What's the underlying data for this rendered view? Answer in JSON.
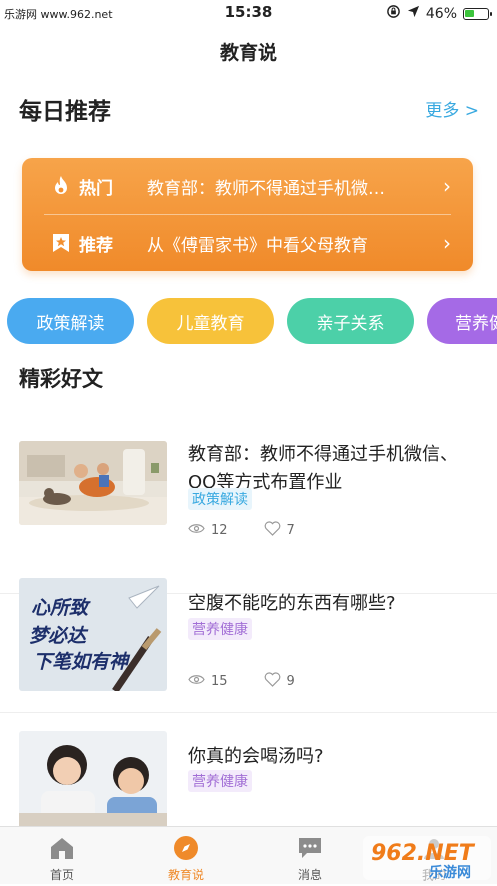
{
  "status": {
    "watermark": "乐游网 www.962.net",
    "time": "15:38",
    "battery": "46%",
    "battery_level": 0.46
  },
  "nav": {
    "title": "教育说"
  },
  "daily": {
    "heading": "每日推荐",
    "more": "更多 >",
    "items": [
      {
        "tag": "热门",
        "text": "教育部：教师不得通过手机微…",
        "icon": "flame-icon"
      },
      {
        "tag": "推荐",
        "text": "从《傅雷家书》中看父母教育",
        "icon": "star-badge-icon"
      }
    ]
  },
  "categories": [
    {
      "label": "政策解读",
      "color": "#4aaaf0"
    },
    {
      "label": "儿童教育",
      "color": "#f7c23a"
    },
    {
      "label": "亲子关系",
      "color": "#4cd0a8"
    },
    {
      "label": "营养健",
      "color": "#a56ae6"
    }
  ],
  "articles_section": {
    "heading": "精彩好文"
  },
  "articles": [
    {
      "title": "教育部：教师不得通过手机微信、QQ等方式布置作业",
      "tag": "政策解读",
      "views": "12",
      "likes": "7"
    },
    {
      "title": "空腹不能吃的东西有哪些?",
      "tag": "营养健康",
      "views": "15",
      "likes": "9",
      "thumb_text": [
        "心所致",
        "梦必达",
        "下笔如有神"
      ]
    },
    {
      "title": "你真的会喝汤吗?",
      "tag": "营养健康"
    }
  ],
  "tabs": [
    {
      "label": "首页",
      "icon": "home-icon"
    },
    {
      "label": "教育说",
      "icon": "compass-icon"
    },
    {
      "label": "消息",
      "icon": "message-icon"
    },
    {
      "label": "我的",
      "icon": "user-icon"
    }
  ],
  "watermark": {
    "brand": "962.NET",
    "sub": "乐游网"
  },
  "colors": {
    "accent": "#ef8a2a",
    "link": "#39a9e0",
    "card": "#f3932f"
  }
}
